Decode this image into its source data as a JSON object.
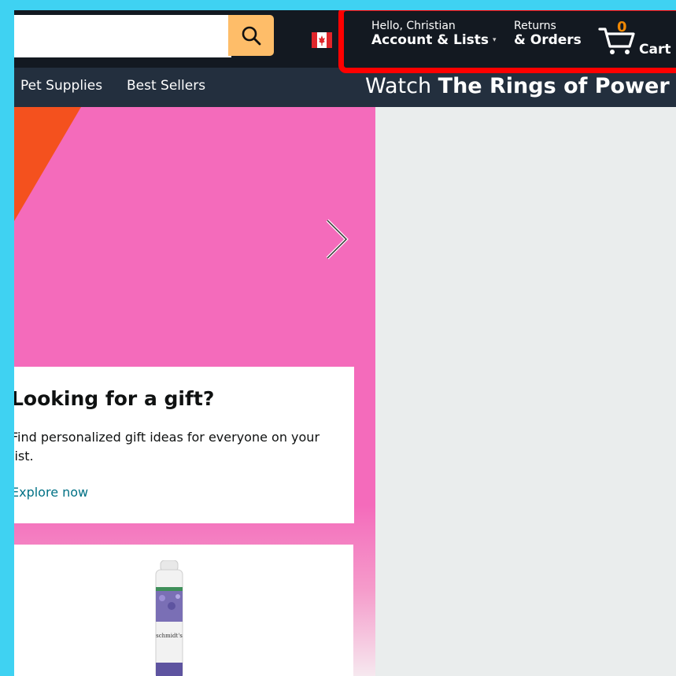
{
  "header": {
    "search_placeholder": "",
    "account": {
      "greeting": "Hello, Christian",
      "label": "Account & Lists",
      "caret": "▾"
    },
    "orders": {
      "line1": "Returns",
      "line2": "& Orders"
    },
    "cart": {
      "count": "0",
      "label": "Cart"
    }
  },
  "nav": {
    "items": [
      "Pet Supplies",
      "Best Sellers"
    ],
    "promo_prefix": "Watch ",
    "promo_bold": "The Rings of Power"
  },
  "hero": {
    "gift_card": {
      "title": "Looking for a gift?",
      "description": "Find personalized gift ideas for everyone on your list.",
      "link": "Explore now"
    },
    "product": {
      "brand": "schmidt's"
    }
  },
  "icons": {
    "search": "search-icon",
    "flag": "canada-flag-icon",
    "cart": "cart-icon",
    "carousel_next": "chevron-right-icon"
  },
  "colors": {
    "accent": "#febd69",
    "header_bg": "#131921",
    "nav_bg": "#232f3e",
    "link": "#007185",
    "cart_count": "#f08804",
    "highlight": "#ff0000",
    "hero_pink": "#f46bbb"
  }
}
